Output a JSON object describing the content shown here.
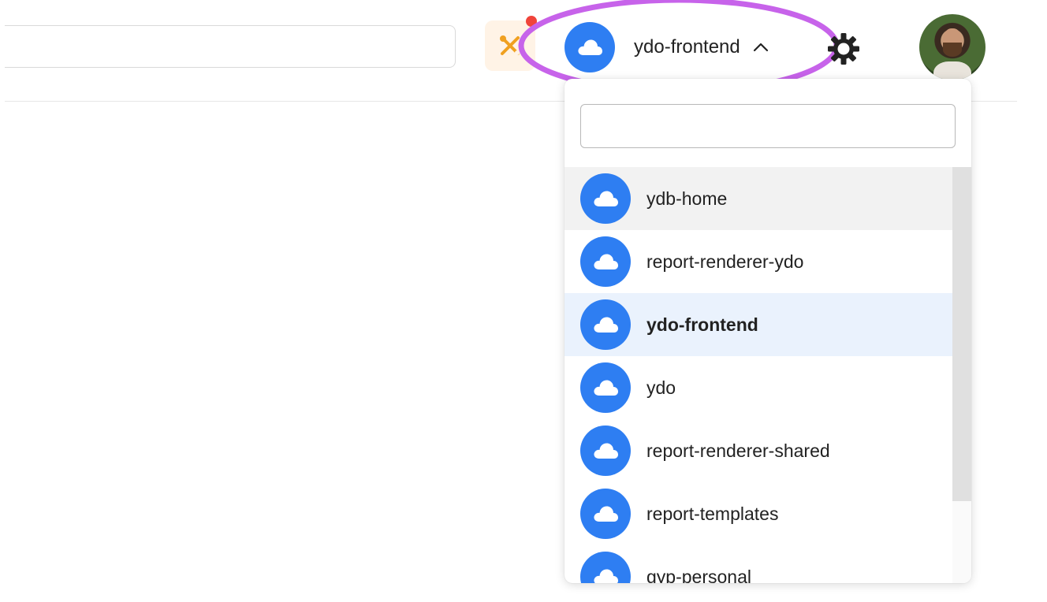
{
  "header": {
    "search": {
      "value": "",
      "placeholder": ""
    },
    "tools_icon": "tools-icon",
    "notification_color": "#f0443a",
    "project_switcher": {
      "label": "ydo-frontend",
      "icon": "cloud-icon",
      "chevron": "chevron-up-icon",
      "expanded": true
    },
    "settings_icon": "gear-icon",
    "avatar": "user-avatar"
  },
  "dropdown": {
    "search": {
      "value": "",
      "placeholder": ""
    },
    "items": [
      {
        "label": "ydb-home",
        "state": "hover"
      },
      {
        "label": "report-renderer-ydo",
        "state": ""
      },
      {
        "label": "ydo-frontend",
        "state": "selected"
      },
      {
        "label": "ydo",
        "state": ""
      },
      {
        "label": "report-renderer-shared",
        "state": ""
      },
      {
        "label": "report-templates",
        "state": ""
      },
      {
        "label": "gyp-personal",
        "state": ""
      }
    ]
  },
  "colors": {
    "accent": "#2e7ef2",
    "highlight_annotation": "#c763ea",
    "selected_row": "#eaf2fd",
    "hover_row": "#f2f2f2",
    "tools_bg": "#fff3e6"
  }
}
